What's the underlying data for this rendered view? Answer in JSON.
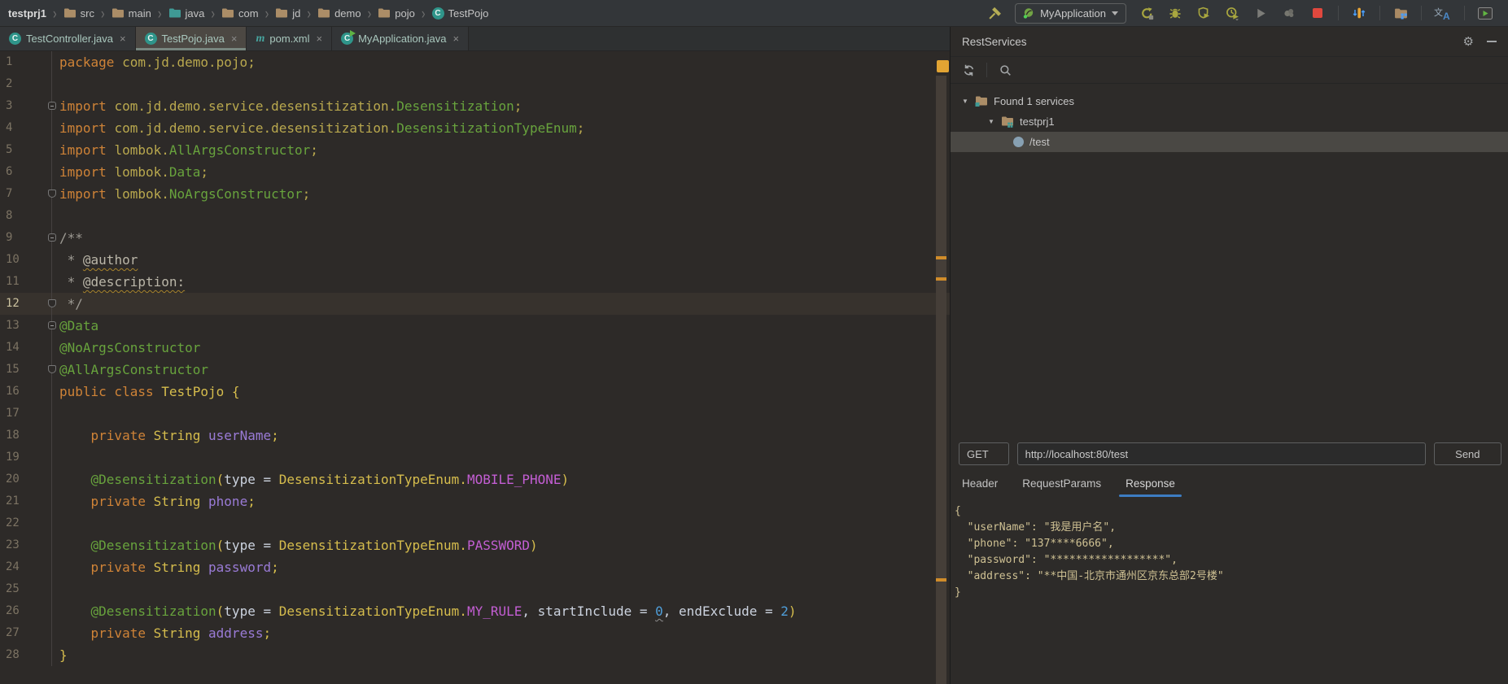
{
  "breadcrumb": {
    "project": "testprj1",
    "items": [
      {
        "label": "src",
        "icon": "folder"
      },
      {
        "label": "main",
        "icon": "folder"
      },
      {
        "label": "java",
        "icon": "source-folder"
      },
      {
        "label": "com",
        "icon": "folder"
      },
      {
        "label": "jd",
        "icon": "folder"
      },
      {
        "label": "demo",
        "icon": "folder"
      },
      {
        "label": "pojo",
        "icon": "folder"
      },
      {
        "label": "TestPojo",
        "icon": "class"
      }
    ]
  },
  "toolbar": {
    "run_config": "MyApplication"
  },
  "tabs": [
    {
      "label": "TestController.java",
      "icon": "class",
      "active": false
    },
    {
      "label": "TestPojo.java",
      "icon": "class",
      "active": true
    },
    {
      "label": "pom.xml",
      "icon": "maven",
      "active": false
    },
    {
      "label": "MyApplication.java",
      "icon": "class-run",
      "active": false
    }
  ],
  "editor": {
    "current_line": 12,
    "lines": [
      {
        "n": 1,
        "seg": [
          [
            "package ",
            "kw"
          ],
          [
            "com.jd.demo.pojo;",
            "pkg"
          ]
        ]
      },
      {
        "n": 2,
        "seg": []
      },
      {
        "n": 3,
        "fold": "start",
        "seg": [
          [
            "import ",
            "kw"
          ],
          [
            "com.jd.demo.service.desensitization.",
            "pkg"
          ],
          [
            "Desensitization",
            "cls"
          ],
          [
            ";",
            "pkg"
          ]
        ]
      },
      {
        "n": 4,
        "seg": [
          [
            "import ",
            "kw"
          ],
          [
            "com.jd.demo.service.desensitization.",
            "pkg"
          ],
          [
            "DesensitizationTypeEnum",
            "cls"
          ],
          [
            ";",
            "pkg"
          ]
        ]
      },
      {
        "n": 5,
        "seg": [
          [
            "import ",
            "kw"
          ],
          [
            "lombok.",
            "pkg"
          ],
          [
            "AllArgsConstructor",
            "cls"
          ],
          [
            ";",
            "pkg"
          ]
        ]
      },
      {
        "n": 6,
        "seg": [
          [
            "import ",
            "kw"
          ],
          [
            "lombok.",
            "pkg"
          ],
          [
            "Data",
            "cls"
          ],
          [
            ";",
            "pkg"
          ]
        ]
      },
      {
        "n": 7,
        "fold": "end",
        "seg": [
          [
            "import ",
            "kw"
          ],
          [
            "lombok.",
            "pkg"
          ],
          [
            "NoArgsConstructor",
            "cls"
          ],
          [
            ";",
            "pkg"
          ]
        ]
      },
      {
        "n": 8,
        "seg": []
      },
      {
        "n": 9,
        "fold": "start",
        "seg": [
          [
            "/**",
            "doc"
          ]
        ]
      },
      {
        "n": 10,
        "seg": [
          [
            " * ",
            "doc"
          ],
          [
            "@author",
            "doctag"
          ]
        ]
      },
      {
        "n": 11,
        "seg": [
          [
            " * ",
            "doc"
          ],
          [
            "@description:",
            "doctag"
          ]
        ]
      },
      {
        "n": 12,
        "cur": true,
        "fold": "end",
        "seg": [
          [
            " */",
            "doc"
          ]
        ]
      },
      {
        "n": 13,
        "fold": "start",
        "seg": [
          [
            "@Data",
            "ann"
          ]
        ]
      },
      {
        "n": 14,
        "seg": [
          [
            "@NoArgsConstructor",
            "ann"
          ]
        ]
      },
      {
        "n": 15,
        "fold": "end",
        "seg": [
          [
            "@AllArgsConstructor",
            "ann"
          ]
        ]
      },
      {
        "n": 16,
        "seg": [
          [
            "public class ",
            "kw"
          ],
          [
            "TestPojo",
            "typ"
          ],
          [
            " {",
            "pun"
          ]
        ]
      },
      {
        "n": 17,
        "seg": []
      },
      {
        "n": 18,
        "seg": [
          [
            "    ",
            "pln"
          ],
          [
            "private ",
            "kw"
          ],
          [
            "String ",
            "typ"
          ],
          [
            "userName",
            "fld"
          ],
          [
            ";",
            "pun"
          ]
        ]
      },
      {
        "n": 19,
        "seg": []
      },
      {
        "n": 20,
        "seg": [
          [
            "    ",
            "pln"
          ],
          [
            "@Desensitization",
            "ann"
          ],
          [
            "(",
            "pun"
          ],
          [
            "type",
            "attr"
          ],
          [
            " = ",
            "attr"
          ],
          [
            "DesensitizationTypeEnum",
            "typ"
          ],
          [
            ".",
            "pun"
          ],
          [
            "MOBILE_PHONE",
            "enm"
          ],
          [
            ")",
            "pun"
          ]
        ]
      },
      {
        "n": 21,
        "seg": [
          [
            "    ",
            "pln"
          ],
          [
            "private ",
            "kw"
          ],
          [
            "String ",
            "typ"
          ],
          [
            "phone",
            "fld"
          ],
          [
            ";",
            "pun"
          ]
        ]
      },
      {
        "n": 22,
        "seg": []
      },
      {
        "n": 23,
        "seg": [
          [
            "    ",
            "pln"
          ],
          [
            "@Desensitization",
            "ann"
          ],
          [
            "(",
            "pun"
          ],
          [
            "type",
            "attr"
          ],
          [
            " = ",
            "attr"
          ],
          [
            "DesensitizationTypeEnum",
            "typ"
          ],
          [
            ".",
            "pun"
          ],
          [
            "PASSWORD",
            "enm"
          ],
          [
            ")",
            "pun"
          ]
        ]
      },
      {
        "n": 24,
        "seg": [
          [
            "    ",
            "pln"
          ],
          [
            "private ",
            "kw"
          ],
          [
            "String ",
            "typ"
          ],
          [
            "password",
            "fld"
          ],
          [
            ";",
            "pun"
          ]
        ]
      },
      {
        "n": 25,
        "seg": []
      },
      {
        "n": 26,
        "seg": [
          [
            "    ",
            "pln"
          ],
          [
            "@Desensitization",
            "ann"
          ],
          [
            "(",
            "pun"
          ],
          [
            "type",
            "attr"
          ],
          [
            " = ",
            "attr"
          ],
          [
            "DesensitizationTypeEnum",
            "typ"
          ],
          [
            ".",
            "pun"
          ],
          [
            "MY_RULE",
            "enm"
          ],
          [
            ", ",
            "attr"
          ],
          [
            "startInclude",
            "attr"
          ],
          [
            " = ",
            "attr"
          ],
          [
            "0",
            "numw"
          ],
          [
            ", ",
            "attr"
          ],
          [
            "endExclude",
            "attr"
          ],
          [
            " = ",
            "attr"
          ],
          [
            "2",
            "num"
          ],
          [
            ")",
            "pun"
          ]
        ]
      },
      {
        "n": 27,
        "seg": [
          [
            "    ",
            "pln"
          ],
          [
            "private ",
            "kw"
          ],
          [
            "String ",
            "typ"
          ],
          [
            "address",
            "fld"
          ],
          [
            ";",
            "pun"
          ]
        ]
      },
      {
        "n": 28,
        "seg": [
          [
            "}",
            "pun"
          ]
        ]
      }
    ]
  },
  "rest_panel": {
    "title": "RestServices",
    "tree": [
      {
        "label": "Found 1 services",
        "level": 0,
        "icon": "services-folder",
        "expanded": true,
        "selected": false
      },
      {
        "label": "testprj1",
        "level": 1,
        "icon": "module-folder",
        "expanded": true,
        "selected": false
      },
      {
        "label": "/test",
        "level": 2,
        "icon": "endpoint",
        "expanded": false,
        "selected": true
      }
    ],
    "request": {
      "method": "GET",
      "url": "http://localhost:80/test",
      "send_label": "Send"
    },
    "tabs": [
      "Header",
      "RequestParams",
      "Response"
    ],
    "active_tab": "Response",
    "response_lines": [
      "{",
      "  \"userName\": \"我是用户名\",",
      "  \"phone\": \"137****6666\",",
      "  \"password\": \"******************\",",
      "  \"address\": \"**中国-北京市通州区京东总部2号楼\"",
      "}"
    ]
  },
  "colors": {
    "accent_blue": "#3d7dc2",
    "warning_orange": "#d99e3a",
    "stop_red": "#e0483e",
    "keyword_orange": "#cf8337",
    "annotation_green": "#68a33d",
    "type_yellow": "#d6bd4d",
    "field_purple": "#9a7bd6",
    "enum_magenta": "#c35ed3",
    "number_blue": "#4f9ed9"
  }
}
